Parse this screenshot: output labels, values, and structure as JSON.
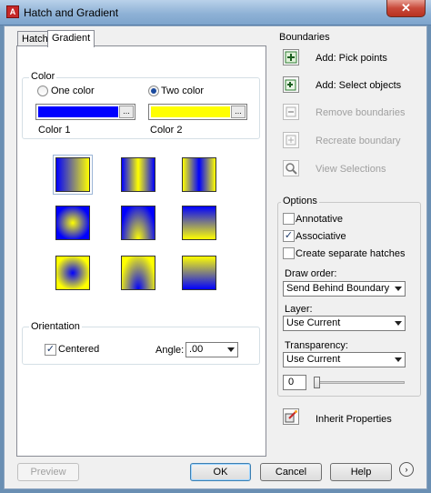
{
  "window": {
    "title": "Hatch and Gradient",
    "close_label": "✕"
  },
  "tabs": [
    {
      "label": "Hatch"
    },
    {
      "label": "Gradient"
    }
  ],
  "color": {
    "group_label": "Color",
    "one_color_label": "One color",
    "two_color_label": "Two color",
    "selected_mode": "Two color",
    "color1_label": "Color 1",
    "color2_label": "Color 2",
    "color1_hex": "#0000ff",
    "color2_hex": "#ffff00",
    "browse_label": "..."
  },
  "gradient_patterns": [
    "linear",
    "cylinder",
    "inverted-cylinder",
    "spherical",
    "hemispherical",
    "curved",
    "inverted-spherical",
    "inverted-hemispherical",
    "inverted-curved"
  ],
  "orientation": {
    "group_label": "Orientation",
    "centered_label": "Centered",
    "centered_checked": true,
    "angle_label": "Angle:",
    "angle_value": ".00"
  },
  "boundaries": {
    "group_label": "Boundaries",
    "items": [
      {
        "label": "Add: Pick points",
        "icon": "pick-points-icon",
        "enabled": true
      },
      {
        "label": "Add: Select objects",
        "icon": "select-objects-icon",
        "enabled": true
      },
      {
        "label": "Remove boundaries",
        "icon": "remove-boundaries-icon",
        "enabled": false
      },
      {
        "label": "Recreate boundary",
        "icon": "recreate-boundary-icon",
        "enabled": false
      },
      {
        "label": "View Selections",
        "icon": "view-selections-icon",
        "enabled": false
      }
    ]
  },
  "options": {
    "group_label": "Options",
    "annotative_label": "Annotative",
    "annotative_checked": false,
    "associative_label": "Associative",
    "associative_checked": true,
    "separate_label": "Create separate hatches",
    "separate_checked": false,
    "draw_order_label": "Draw order:",
    "draw_order_value": "Send Behind Boundary",
    "layer_label": "Layer:",
    "layer_value": "Use Current",
    "transparency_label": "Transparency:",
    "transparency_value": "Use Current",
    "transparency_amount": "0"
  },
  "inherit_label": "Inherit Properties",
  "footer": {
    "preview_label": "Preview",
    "ok_label": "OK",
    "cancel_label": "Cancel",
    "help_label": "Help",
    "more_label": "›"
  },
  "colors": {
    "blue": "#0000ff",
    "yellow": "#ffff00",
    "dialog_bg": "#f0f0f0",
    "titlebar": "#8fb2d6"
  }
}
